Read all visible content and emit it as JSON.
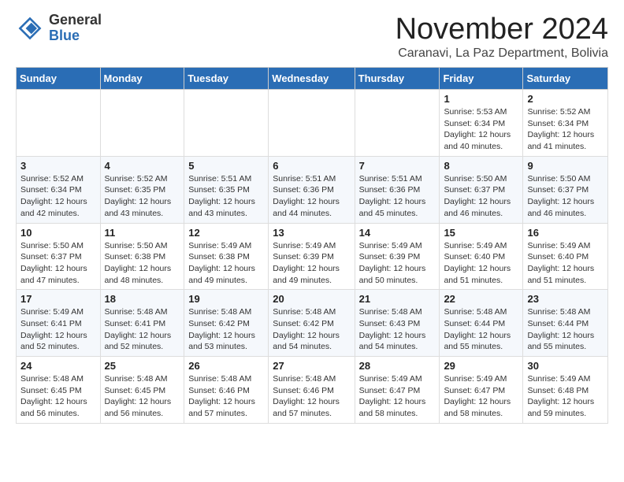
{
  "logo": {
    "general": "General",
    "blue": "Blue"
  },
  "header": {
    "month": "November 2024",
    "location": "Caranavi, La Paz Department, Bolivia"
  },
  "weekdays": [
    "Sunday",
    "Monday",
    "Tuesday",
    "Wednesday",
    "Thursday",
    "Friday",
    "Saturday"
  ],
  "weeks": [
    [
      {
        "day": "",
        "info": ""
      },
      {
        "day": "",
        "info": ""
      },
      {
        "day": "",
        "info": ""
      },
      {
        "day": "",
        "info": ""
      },
      {
        "day": "",
        "info": ""
      },
      {
        "day": "1",
        "info": "Sunrise: 5:53 AM\nSunset: 6:34 PM\nDaylight: 12 hours and 40 minutes."
      },
      {
        "day": "2",
        "info": "Sunrise: 5:52 AM\nSunset: 6:34 PM\nDaylight: 12 hours and 41 minutes."
      }
    ],
    [
      {
        "day": "3",
        "info": "Sunrise: 5:52 AM\nSunset: 6:34 PM\nDaylight: 12 hours and 42 minutes."
      },
      {
        "day": "4",
        "info": "Sunrise: 5:52 AM\nSunset: 6:35 PM\nDaylight: 12 hours and 43 minutes."
      },
      {
        "day": "5",
        "info": "Sunrise: 5:51 AM\nSunset: 6:35 PM\nDaylight: 12 hours and 43 minutes."
      },
      {
        "day": "6",
        "info": "Sunrise: 5:51 AM\nSunset: 6:36 PM\nDaylight: 12 hours and 44 minutes."
      },
      {
        "day": "7",
        "info": "Sunrise: 5:51 AM\nSunset: 6:36 PM\nDaylight: 12 hours and 45 minutes."
      },
      {
        "day": "8",
        "info": "Sunrise: 5:50 AM\nSunset: 6:37 PM\nDaylight: 12 hours and 46 minutes."
      },
      {
        "day": "9",
        "info": "Sunrise: 5:50 AM\nSunset: 6:37 PM\nDaylight: 12 hours and 46 minutes."
      }
    ],
    [
      {
        "day": "10",
        "info": "Sunrise: 5:50 AM\nSunset: 6:37 PM\nDaylight: 12 hours and 47 minutes."
      },
      {
        "day": "11",
        "info": "Sunrise: 5:50 AM\nSunset: 6:38 PM\nDaylight: 12 hours and 48 minutes."
      },
      {
        "day": "12",
        "info": "Sunrise: 5:49 AM\nSunset: 6:38 PM\nDaylight: 12 hours and 49 minutes."
      },
      {
        "day": "13",
        "info": "Sunrise: 5:49 AM\nSunset: 6:39 PM\nDaylight: 12 hours and 49 minutes."
      },
      {
        "day": "14",
        "info": "Sunrise: 5:49 AM\nSunset: 6:39 PM\nDaylight: 12 hours and 50 minutes."
      },
      {
        "day": "15",
        "info": "Sunrise: 5:49 AM\nSunset: 6:40 PM\nDaylight: 12 hours and 51 minutes."
      },
      {
        "day": "16",
        "info": "Sunrise: 5:49 AM\nSunset: 6:40 PM\nDaylight: 12 hours and 51 minutes."
      }
    ],
    [
      {
        "day": "17",
        "info": "Sunrise: 5:49 AM\nSunset: 6:41 PM\nDaylight: 12 hours and 52 minutes."
      },
      {
        "day": "18",
        "info": "Sunrise: 5:48 AM\nSunset: 6:41 PM\nDaylight: 12 hours and 52 minutes."
      },
      {
        "day": "19",
        "info": "Sunrise: 5:48 AM\nSunset: 6:42 PM\nDaylight: 12 hours and 53 minutes."
      },
      {
        "day": "20",
        "info": "Sunrise: 5:48 AM\nSunset: 6:42 PM\nDaylight: 12 hours and 54 minutes."
      },
      {
        "day": "21",
        "info": "Sunrise: 5:48 AM\nSunset: 6:43 PM\nDaylight: 12 hours and 54 minutes."
      },
      {
        "day": "22",
        "info": "Sunrise: 5:48 AM\nSunset: 6:44 PM\nDaylight: 12 hours and 55 minutes."
      },
      {
        "day": "23",
        "info": "Sunrise: 5:48 AM\nSunset: 6:44 PM\nDaylight: 12 hours and 55 minutes."
      }
    ],
    [
      {
        "day": "24",
        "info": "Sunrise: 5:48 AM\nSunset: 6:45 PM\nDaylight: 12 hours and 56 minutes."
      },
      {
        "day": "25",
        "info": "Sunrise: 5:48 AM\nSunset: 6:45 PM\nDaylight: 12 hours and 56 minutes."
      },
      {
        "day": "26",
        "info": "Sunrise: 5:48 AM\nSunset: 6:46 PM\nDaylight: 12 hours and 57 minutes."
      },
      {
        "day": "27",
        "info": "Sunrise: 5:48 AM\nSunset: 6:46 PM\nDaylight: 12 hours and 57 minutes."
      },
      {
        "day": "28",
        "info": "Sunrise: 5:49 AM\nSunset: 6:47 PM\nDaylight: 12 hours and 58 minutes."
      },
      {
        "day": "29",
        "info": "Sunrise: 5:49 AM\nSunset: 6:47 PM\nDaylight: 12 hours and 58 minutes."
      },
      {
        "day": "30",
        "info": "Sunrise: 5:49 AM\nSunset: 6:48 PM\nDaylight: 12 hours and 59 minutes."
      }
    ]
  ]
}
